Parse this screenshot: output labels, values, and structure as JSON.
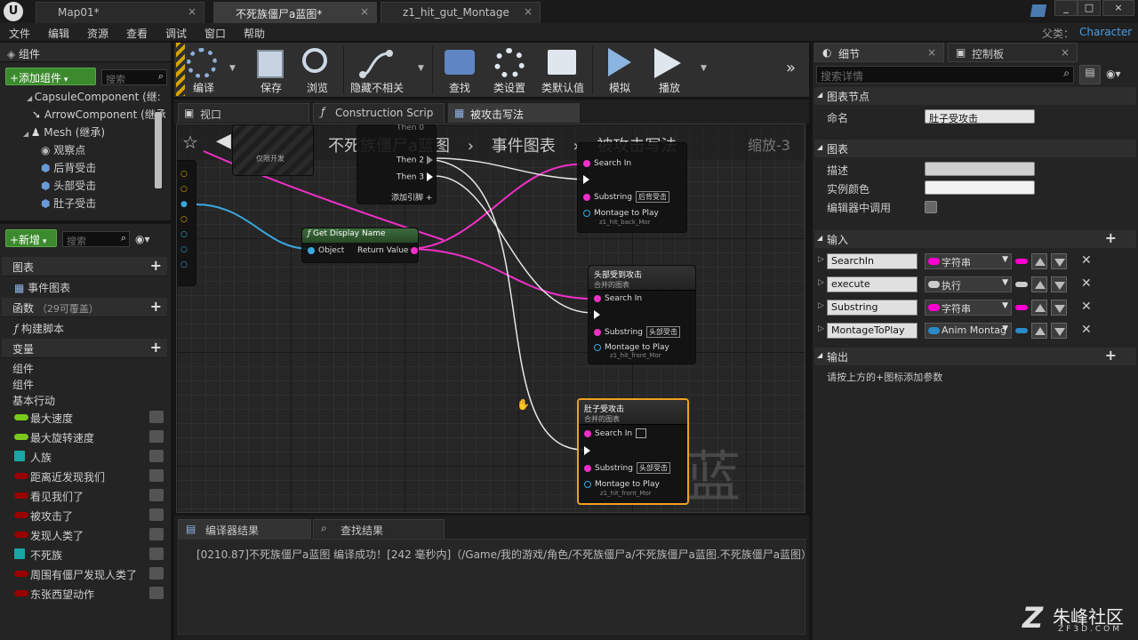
{
  "title_bar": {
    "tabs": [
      {
        "label": "Map01*"
      },
      {
        "label": "不死族僵尸a蓝图*"
      },
      {
        "label": "z1_hit_gut_Montage"
      }
    ],
    "parent_label": "父类：",
    "parent_value": "Character"
  },
  "menu": [
    "文件",
    "编辑",
    "资源",
    "查看",
    "调试",
    "窗口",
    "帮助"
  ],
  "components": {
    "title": "组件",
    "add_button": "+添加组件",
    "search_placeholder": "搜索",
    "items": [
      "CapsuleComponent (继:",
      "ArrowComponent (继承",
      "Mesh (继承)",
      "观察点",
      "后背受击",
      "头部受击",
      "肚子受击"
    ]
  },
  "my_blueprint": {
    "new_button": "+新增",
    "search_placeholder": "搜索",
    "graphs_label": "图表",
    "event_graph": "事件图表",
    "functions_label": "函数",
    "functions_count": "（29可覆盖）",
    "construction_script": "构建脚本",
    "variables_label": "变量",
    "var_groups": [
      "组件",
      "组件",
      "基本行动"
    ],
    "variables": [
      {
        "name": "最大速度",
        "color": "#7ac81d",
        "shape": "pill"
      },
      {
        "name": "最大旋转速度",
        "color": "#7ac81d",
        "shape": "pill"
      },
      {
        "name": "人族",
        "color": "#1aa6a6",
        "shape": "grid"
      },
      {
        "name": "距离近发现我们",
        "color": "#990000",
        "shape": "pill"
      },
      {
        "name": "看见我们了",
        "color": "#990000",
        "shape": "pill"
      },
      {
        "name": "被攻击了",
        "color": "#990000",
        "shape": "pill"
      },
      {
        "name": "发现人类了",
        "color": "#990000",
        "shape": "pill"
      },
      {
        "name": "不死族",
        "color": "#1aa6a6",
        "shape": "grid"
      },
      {
        "name": "周围有僵尸发现人类了",
        "color": "#990000",
        "shape": "pill"
      },
      {
        "name": "东张西望动作",
        "color": "#990000",
        "shape": "pill"
      }
    ]
  },
  "toolbar": [
    {
      "label": "编译",
      "icon": "compile-icon"
    },
    {
      "label": "保存",
      "icon": "save-icon"
    },
    {
      "label": "浏览",
      "icon": "browse-icon"
    },
    {
      "label": "隐藏不相关",
      "icon": "hide-unrelated-icon"
    },
    {
      "label": "查找",
      "icon": "find-icon"
    },
    {
      "label": "类设置",
      "icon": "class-settings-icon"
    },
    {
      "label": "类默认值",
      "icon": "class-defaults-icon"
    },
    {
      "label": "模拟",
      "icon": "simulate-icon"
    },
    {
      "label": "播放",
      "icon": "play-icon"
    }
  ],
  "editor_tabs": [
    "视口",
    "Construction Scrip",
    "被攻击写法"
  ],
  "graph": {
    "breadcrumb": [
      "不死族僵尸a蓝图",
      "事件图表",
      "被攻击写法"
    ],
    "zoom": "缩放-3",
    "watermark": "蓝图",
    "partial_node_label": "仅限开发",
    "sequence": {
      "then0": "Then 0",
      "then2": "Then 2",
      "then3": "Then 3",
      "add_pin": "添加引脚"
    },
    "get_display_name": {
      "title": "Get Display Name",
      "object": "Object",
      "return_value": "Return Value"
    },
    "nodes": [
      {
        "title": "",
        "subtitle": "",
        "search_in": "Search In",
        "substring": "Substring",
        "substring_value": "后背受击",
        "montage": "Montage to Play",
        "montage_value": "z1_hit_back_Mor"
      },
      {
        "title": "头部受到攻击",
        "subtitle": "合并的图表",
        "search_in": "Search In",
        "substring": "Substring",
        "substring_value": "头部受击",
        "montage": "Montage to Play",
        "montage_value": "z1_hit_front_Mor"
      },
      {
        "title": "肚子受攻击",
        "subtitle": "合并的图表",
        "search_in": "Search In",
        "substring": "Substring",
        "substring_value": "头部受击",
        "montage": "Montage to Play",
        "montage_value": "z1_hit_front_Mor"
      }
    ]
  },
  "bottom": {
    "tabs": [
      "编译器结果",
      "查找结果"
    ],
    "log": "[0210.87]不死族僵尸a蓝图 编译成功！[242 毫秒内]（/Game/我的游戏/角色/不死族僵尸a/不死族僵尸a蓝图.不死族僵尸a蓝图）"
  },
  "details": {
    "tab_details": "细节",
    "tab_palette": "控制板",
    "search_placeholder": "搜索详情",
    "graph_node_section": "图表节点",
    "name_label": "命名",
    "name_value": "肚子受攻击",
    "graph_section": "图表",
    "description_label": "描述",
    "instance_color_label": "实例颜色",
    "editor_callable_label": "编辑器中调用",
    "inputs_section": "输入",
    "inputs": [
      {
        "name": "SearchIn",
        "type": "字符串",
        "color": "#ff00d0"
      },
      {
        "name": "execute",
        "type": "执行",
        "color": "#cccccc"
      },
      {
        "name": "Substring",
        "type": "字符串",
        "color": "#ff00d0"
      },
      {
        "name": "MontageToPlay",
        "type": "Anim Montag",
        "color": "#2a8ac7"
      }
    ],
    "outputs_section": "输出",
    "outputs_hint": "请按上方的+图标添加参数"
  },
  "brand": {
    "name": "朱峰社区",
    "url": "ZF3D.COM"
  }
}
